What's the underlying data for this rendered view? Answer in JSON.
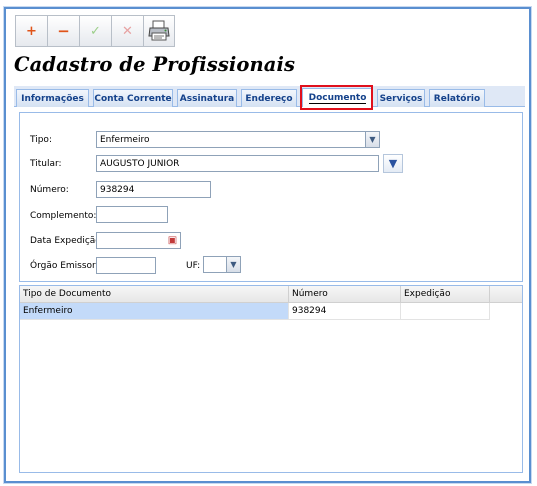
{
  "toolbar": {
    "add_icon": "plus-icon",
    "add_label": "+",
    "remove_icon": "minus-icon",
    "remove_label": "−",
    "confirm_icon": "check-icon",
    "confirm_label": "✓",
    "cancel_icon": "x-icon",
    "cancel_label": "✕",
    "print_icon": "printer-icon"
  },
  "page": {
    "title": "Cadastro de Profissionais"
  },
  "tabs": [
    {
      "label": "Informações"
    },
    {
      "label": "Conta Corrente"
    },
    {
      "label": "Assinatura"
    },
    {
      "label": "Endereço"
    },
    {
      "label": "Documento",
      "active": true
    },
    {
      "label": "Serviços"
    },
    {
      "label": "Relatório"
    }
  ],
  "form": {
    "tipo_label": "Tipo:",
    "tipo_value": "Enfermeiro",
    "titular_label": "Titular:",
    "titular_value": "AUGUSTO JUNIOR",
    "numero_label": "Número:",
    "numero_value": "938294",
    "complemento_label": "Complemento:",
    "complemento_value": "",
    "data_expedicao_label": "Data Expedição:",
    "data_expedicao_value": "",
    "orgao_emissor_label": "Órgão Emissor:",
    "orgao_emissor_value": "",
    "uf_label": "UF:",
    "uf_value": ""
  },
  "grid": {
    "columns": [
      "Tipo de Documento",
      "Número",
      "Expedição"
    ],
    "rows": [
      {
        "tipo": "Enfermeiro",
        "numero": "938294",
        "expedicao": ""
      }
    ]
  },
  "colors": {
    "frame_border": "#5a8fd0",
    "tab_text": "#15428b",
    "highlight": "#e0101c",
    "selected_row": "#c3daf9"
  }
}
